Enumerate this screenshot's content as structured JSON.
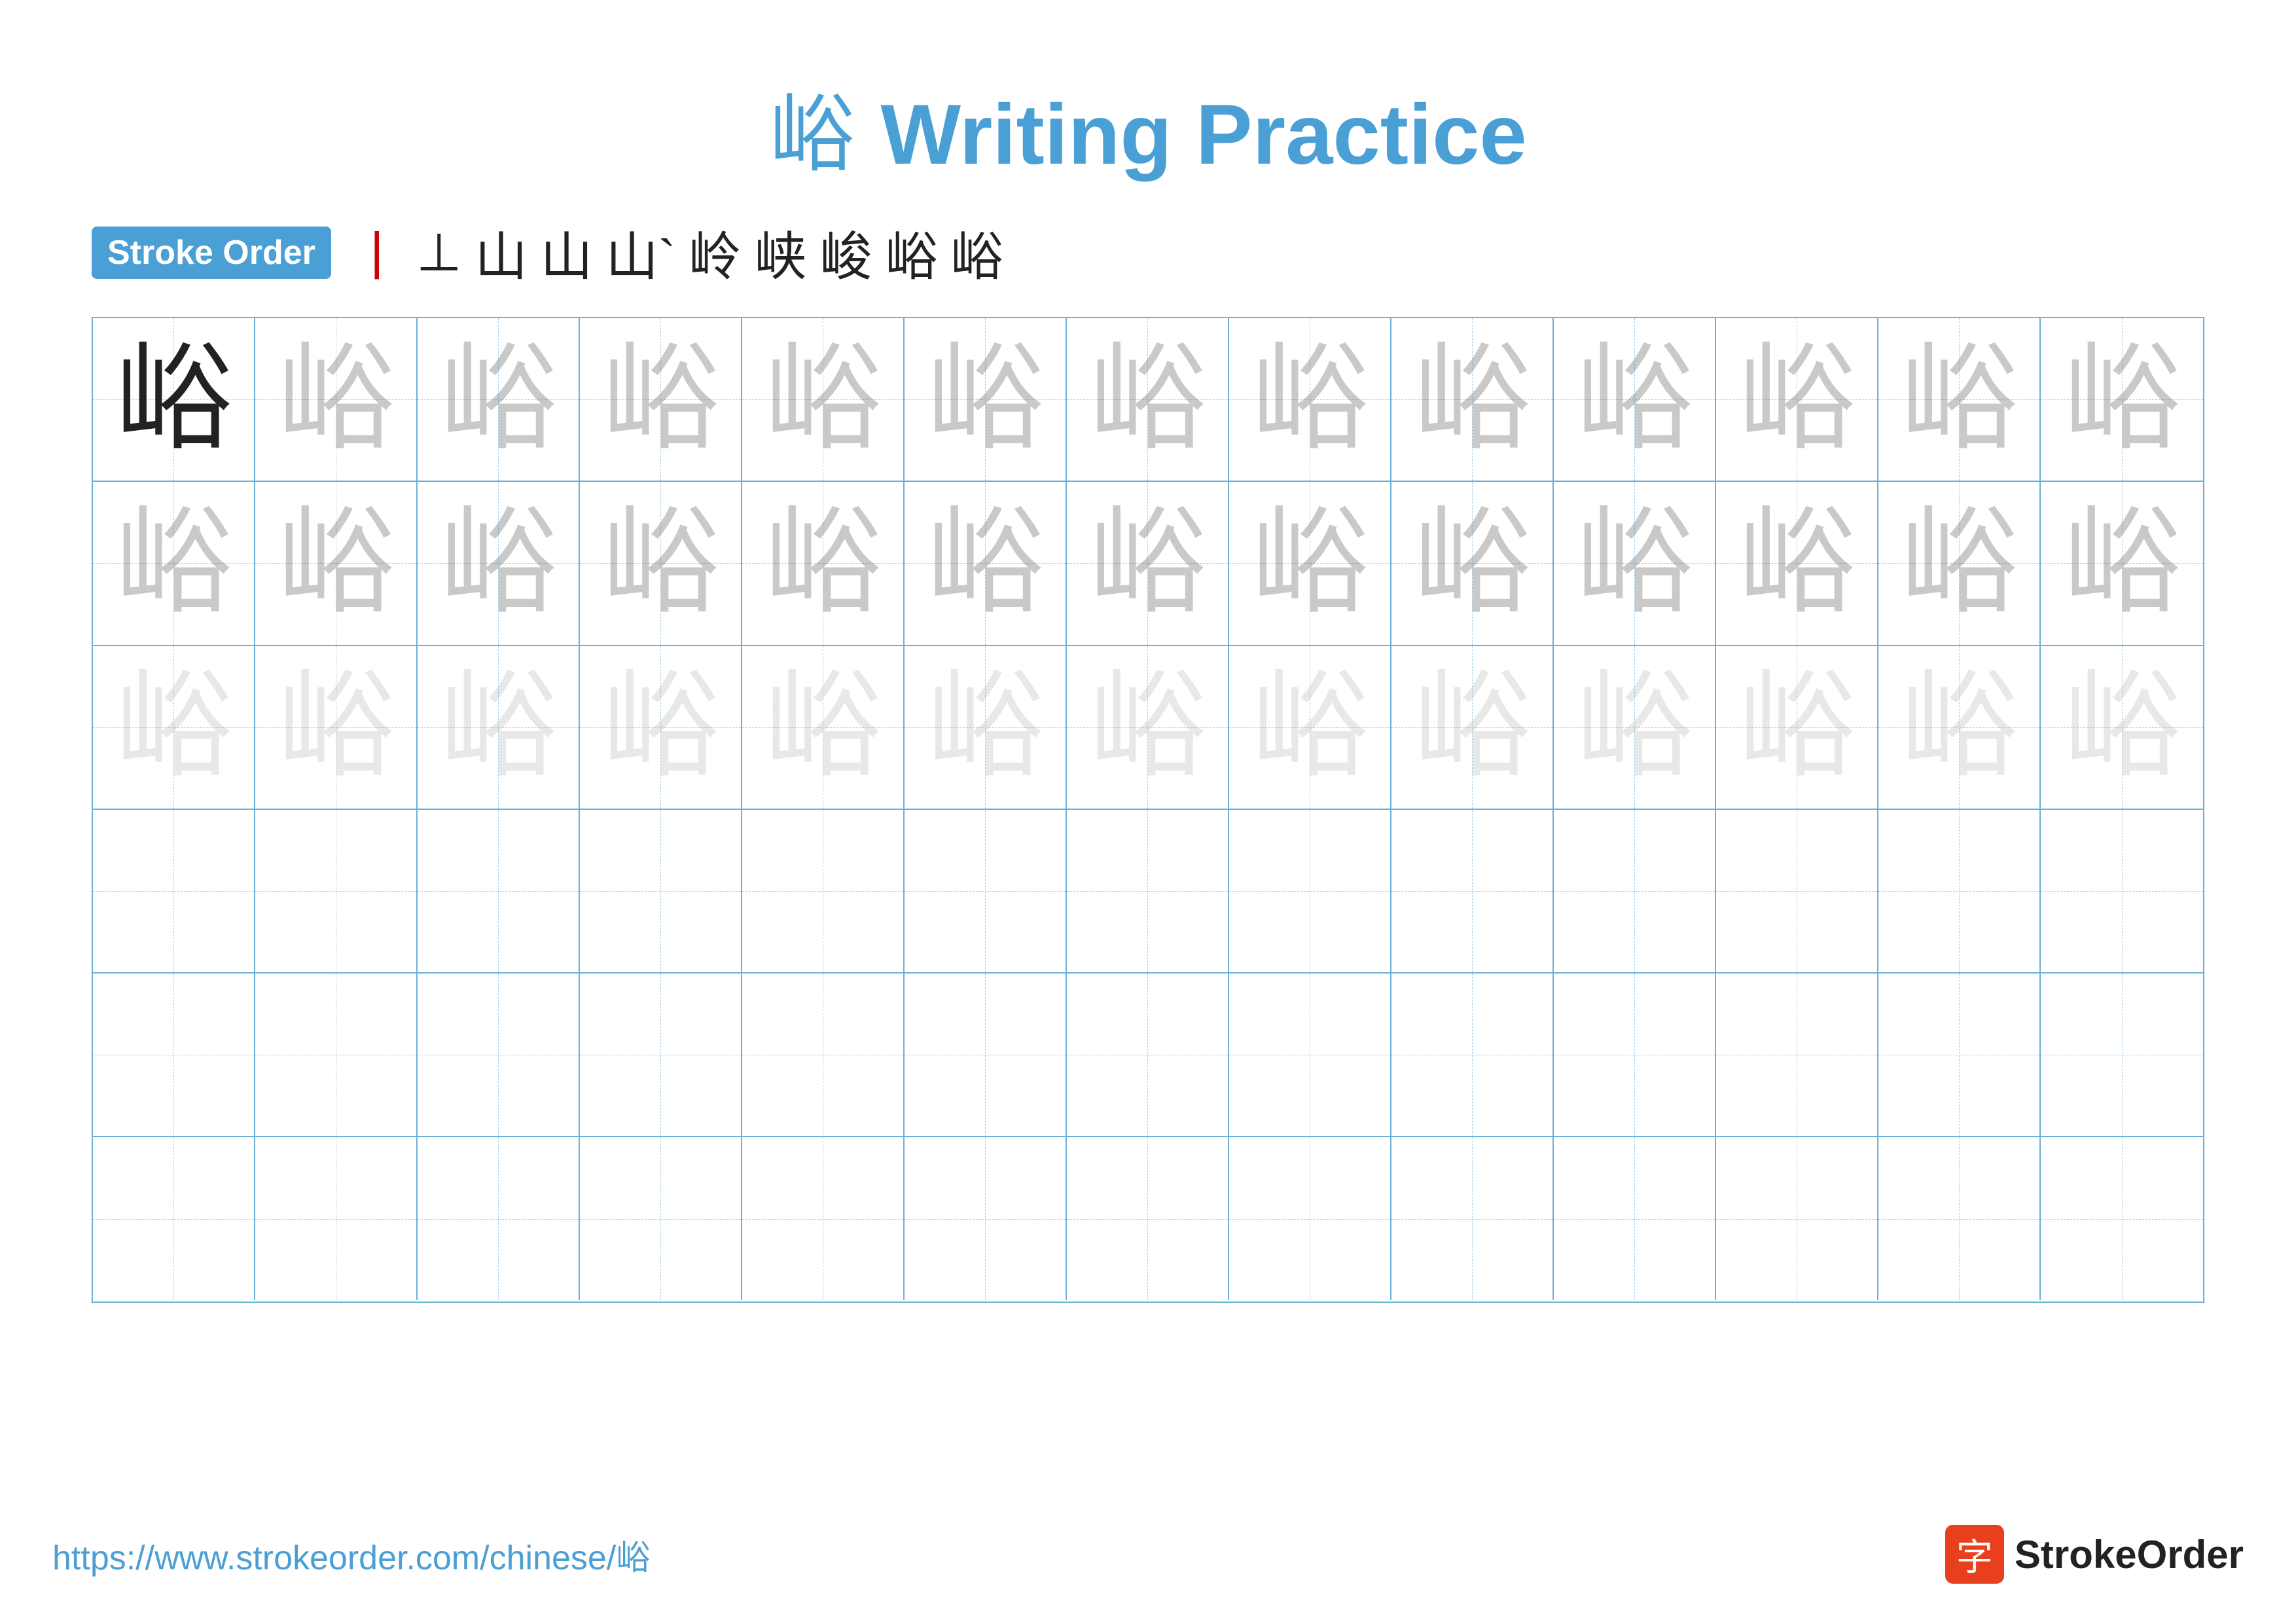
{
  "title": {
    "char": "峪",
    "text": "Writing Practice"
  },
  "stroke_order": {
    "badge_label": "Stroke Order",
    "strokes": [
      "丨",
      "⊥",
      "山",
      "𰀀",
      "𰀁",
      "𰀂",
      "𰀃",
      "𰀄",
      "峪",
      "峪"
    ]
  },
  "stroke_order_display": [
    "丨",
    "卜",
    "山",
    "山",
    "山`",
    "岭",
    "峽",
    "峻",
    "峪",
    "峪"
  ],
  "grid": {
    "rows": 6,
    "cols": 13,
    "char": "峪"
  },
  "footer": {
    "url": "https://www.strokeorder.com/chinese/峪",
    "logo_char": "字",
    "logo_text": "StrokeOrder"
  },
  "colors": {
    "accent": "#4a9fd4",
    "red": "#cc0000",
    "border": "#6ab0d8",
    "guide_dash": "#a8d0eb"
  }
}
